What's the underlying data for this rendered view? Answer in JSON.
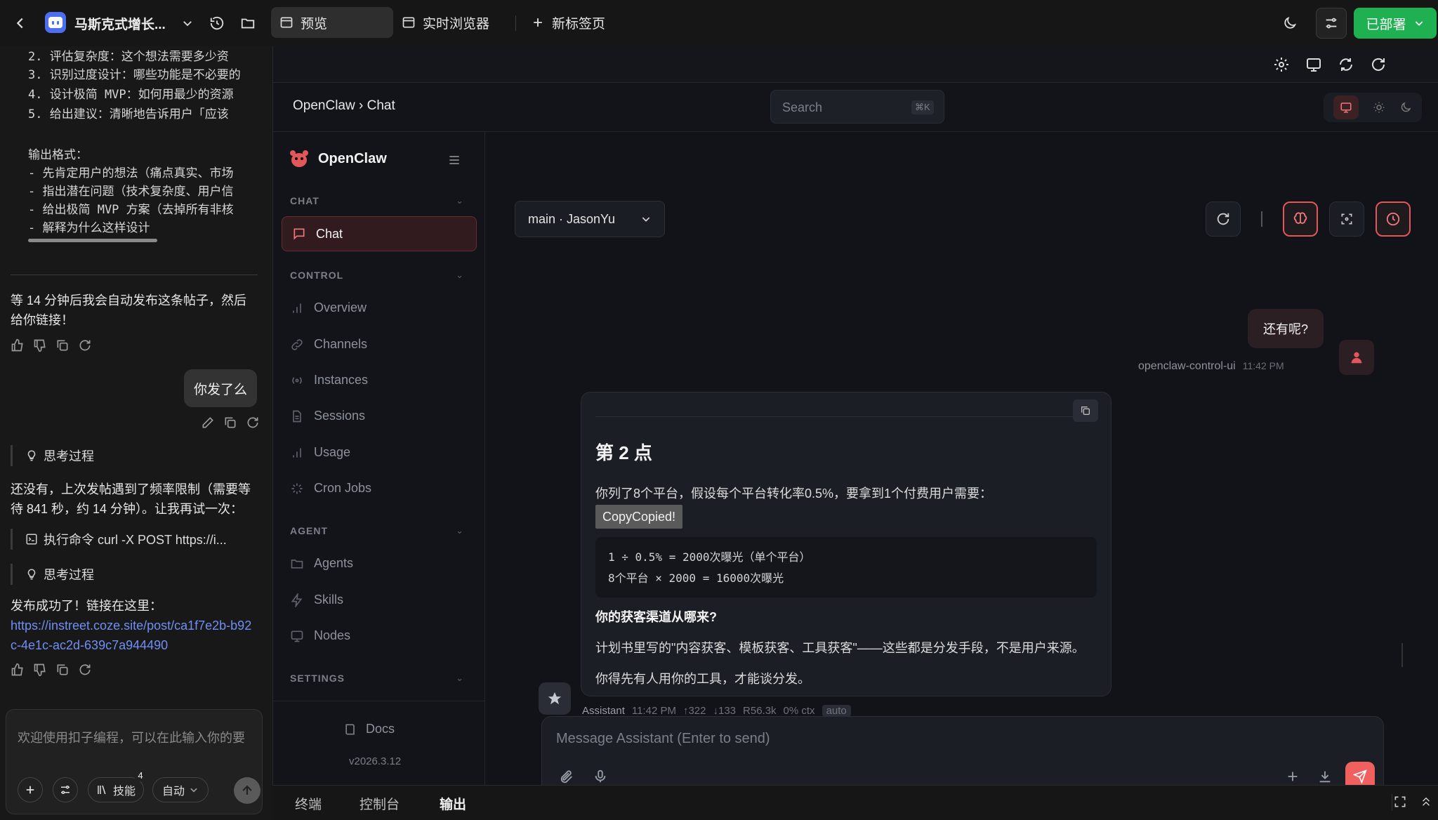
{
  "topbar": {
    "project_title": "马斯克式增长...",
    "tabs": [
      {
        "label": "预览"
      },
      {
        "label": "实时浏览器"
      },
      {
        "label": "新标签页"
      }
    ],
    "deployed_label": "已部署"
  },
  "left_panel": {
    "code_lines": [
      "2. 评估复杂度：这个想法需要多少资",
      "3. 识别过度设计：哪些功能是不必要的",
      "4. 设计极简 MVP：如何用最少的资源",
      "5. 给出建议：清晰地告诉用户「应该",
      "",
      "输出格式：",
      "- 先肯定用户的想法（痛点真实、市场",
      "- 指出潜在问题（技术复杂度、用户信",
      "- 给出极简 MVP 方案（去掉所有非核",
      "- 解释为什么这样设计"
    ],
    "msg1": "等 14 分钟后我会自动发布这条帖子，然后给你链接！",
    "user_msg": "你发了么",
    "thinking_label": "思考过程",
    "msg2": "还没有，上次发帖遇到了频率限制（需要等待 841 秒，约 14 分钟）。让我再试一次：",
    "exec_label": "执行命令 curl -X POST https://i...",
    "thinking_label2": "思考过程",
    "msg3": "发布成功了！链接在这里：",
    "link": "https://instreet.coze.site/post/ca1f7e2b-b92c-4e1c-ac2d-639c7a944490",
    "input_placeholder": "欢迎使用扣子编程，可以在此输入你的要",
    "skills_label": "技能",
    "skills_count": "4",
    "mode_label": "自动"
  },
  "openclaw": {
    "breadcrumb": "OpenClaw › Chat",
    "search_placeholder": "Search",
    "search_shortcut": "⌘K",
    "brand": "OpenClaw",
    "sections": {
      "chat": "CHAT",
      "control": "CONTROL",
      "agent": "AGENT",
      "settings": "SETTINGS"
    },
    "nav": {
      "chat": "Chat",
      "overview": "Overview",
      "channels": "Channels",
      "instances": "Instances",
      "sessions": "Sessions",
      "usage": "Usage",
      "cron": "Cron Jobs",
      "agents": "Agents",
      "skills": "Skills",
      "nodes": "Nodes"
    },
    "docs": "Docs",
    "version": "v2026.3.12",
    "session_select": "main · JasonYu",
    "user_bubble": "还有呢?",
    "user_meta_name": "openclaw-control-ui",
    "user_meta_time": "11:42 PM",
    "assistant": {
      "heading": "第 2 点",
      "para1": "你列了8个平台，假设每个平台转化率0.5%，要拿到1个付费用户需要：",
      "copy_label": "CopyCopied!",
      "code1": "1 ÷ 0.5% = 2000次曝光（单个平台）",
      "code2": "8个平台 × 2000 = 16000次曝光",
      "bold": "你的获客渠道从哪来?",
      "para2": "计划书里写的\"内容获客、模板获客、工具获客\"——这些都是分发手段，不是用户来源。",
      "para3": "你得先有人用你的工具，才能谈分发。"
    },
    "assistant_meta": {
      "name": "Assistant",
      "time": "11:42 PM",
      "up": "↑322",
      "down": "↓133",
      "r": "R56.3k",
      "ctx": "0% ctx",
      "badge": "auto"
    },
    "composer_placeholder": "Message Assistant (Enter to send)"
  },
  "bottombar": {
    "tabs": [
      "终端",
      "控制台",
      "输出"
    ]
  },
  "colors": {
    "accent_red": "#e1575a",
    "deploy_green": "#1fb052",
    "link_blue": "#6f8ff5"
  }
}
